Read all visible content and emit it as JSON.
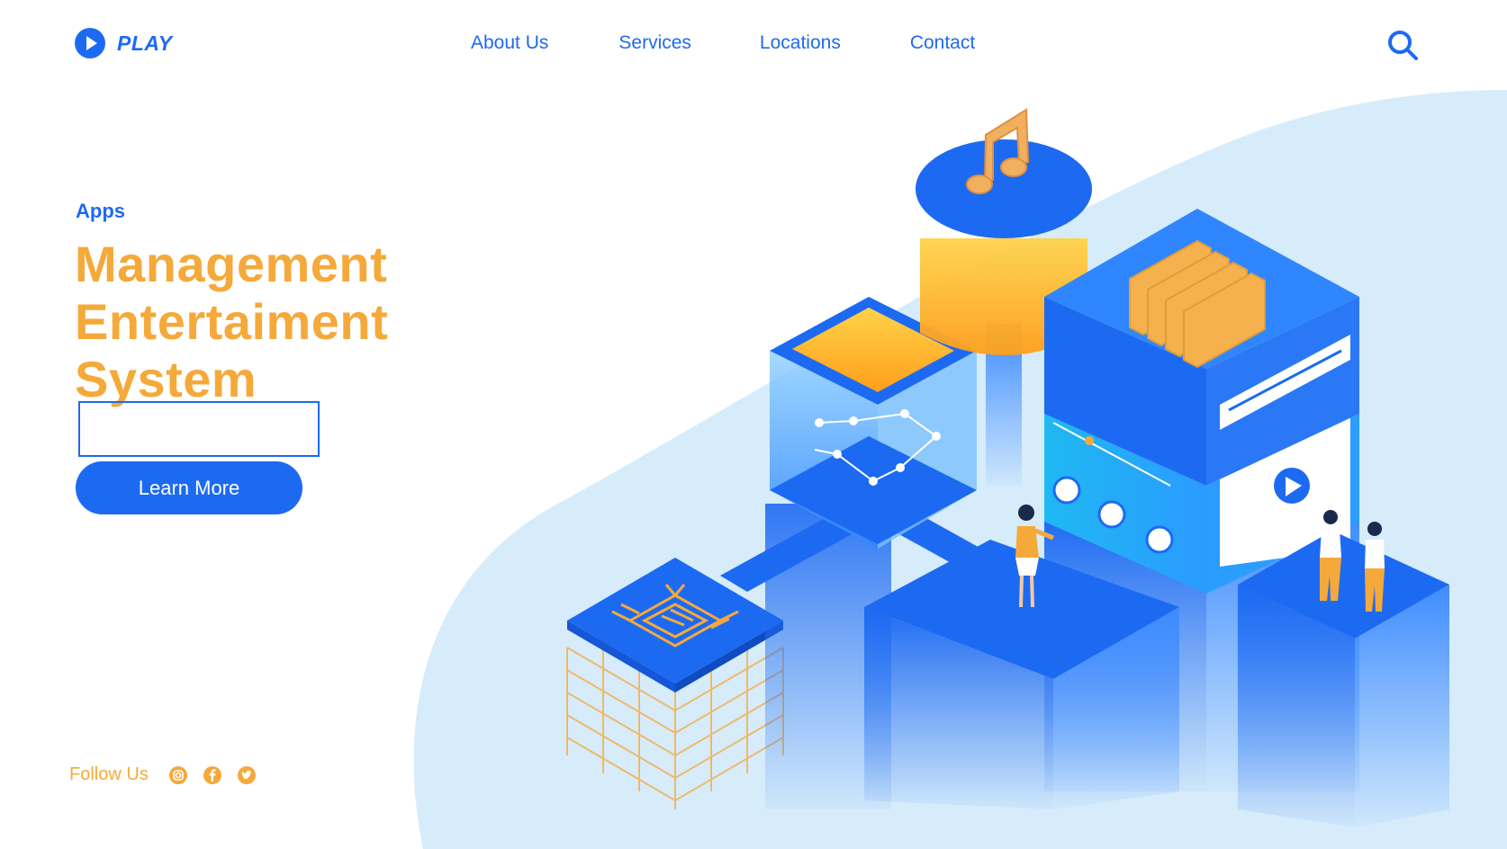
{
  "brand": {
    "name": "PLAY"
  },
  "nav": {
    "items": [
      "About Us",
      "Services",
      "Locations",
      "Contact"
    ]
  },
  "hero": {
    "eyebrow": "Apps",
    "headline_lines": [
      "Management",
      "Entertaiment",
      "System"
    ],
    "input_value": "",
    "cta_label": "Learn More"
  },
  "follow": {
    "label": "Follow Us",
    "icons": [
      "instagram-icon",
      "facebook-icon",
      "twitter-icon"
    ]
  },
  "colors": {
    "primary_blue": "#1d6af2",
    "accent_orange": "#f5a93a",
    "light_blue_bg": "#d6ecfb"
  }
}
